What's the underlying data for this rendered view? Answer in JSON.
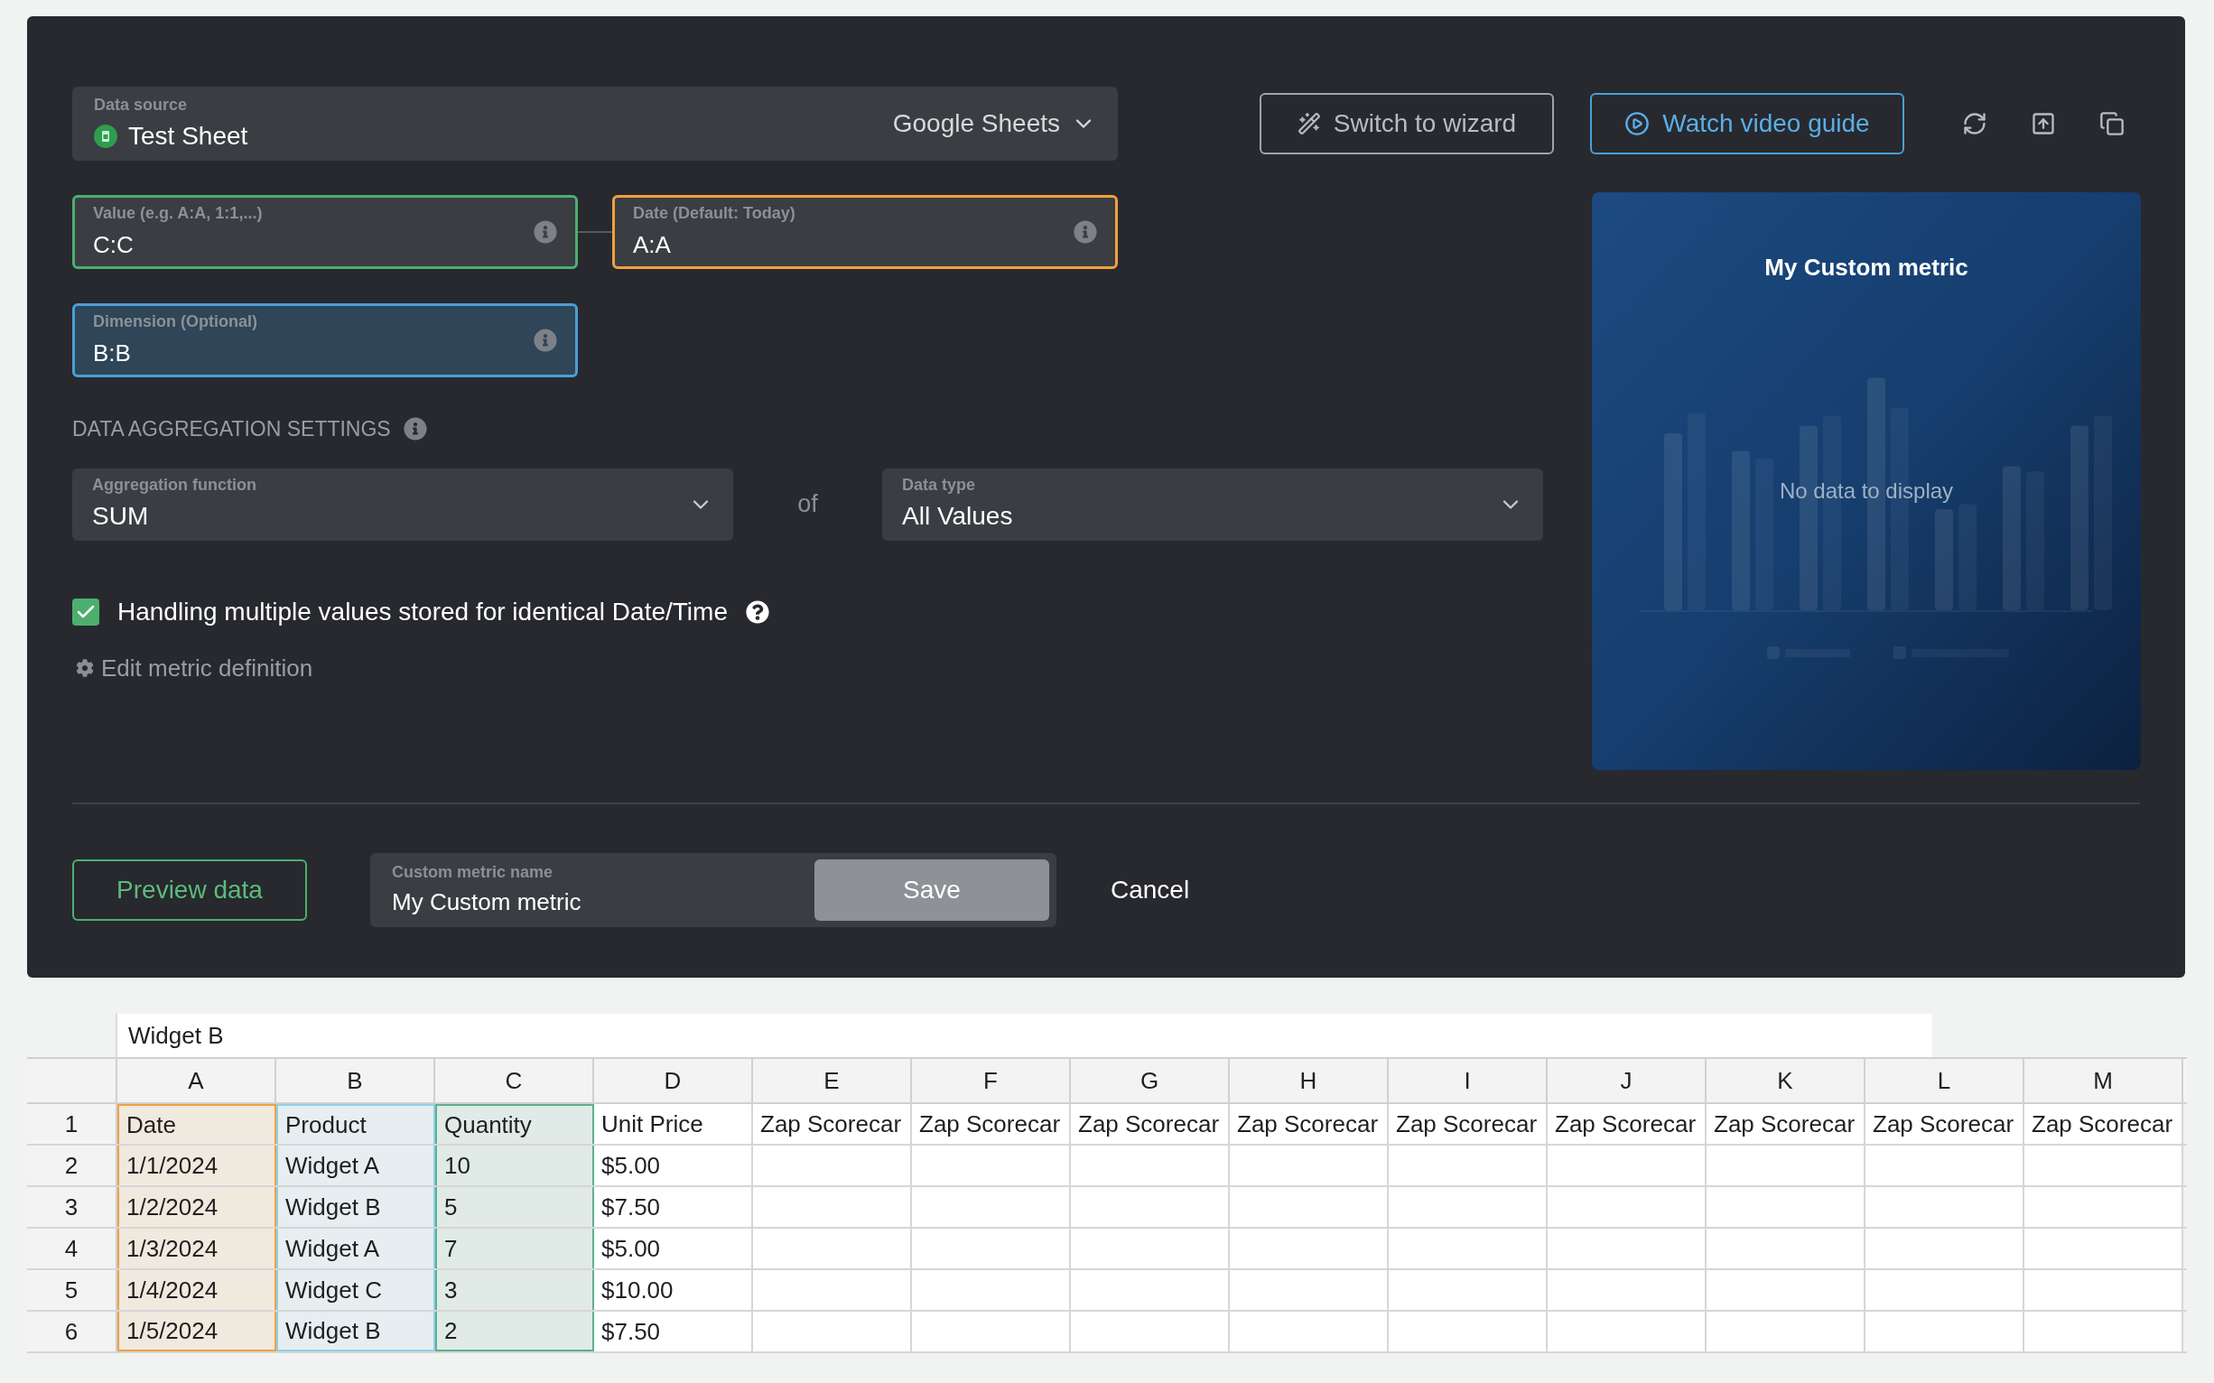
{
  "data_source": {
    "label": "Data source",
    "value": "Test Sheet",
    "provider": "Google Sheets"
  },
  "header_buttons": [
    {
      "kind": "wizard",
      "label": "Switch to wizard"
    },
    {
      "kind": "video",
      "label": "Watch video guide"
    }
  ],
  "fields": [
    {
      "label": "Value (e.g. A:A, 1:1,...)",
      "value": "C:C",
      "color": "#4caf6e",
      "focused": false
    },
    {
      "label": "Date (Default: Today)",
      "value": "A:A",
      "color": "#f0a040",
      "focused": false
    },
    {
      "label": "Dimension (Optional)",
      "value": "B:B",
      "color": "#4a9fd8",
      "focused": true
    }
  ],
  "aggregation": {
    "heading": "DATA AGGREGATION SETTINGS",
    "function_label": "Aggregation function",
    "function_value": "SUM",
    "joiner": "of",
    "type_label": "Data type",
    "type_value": "All Values"
  },
  "handling_multiple": {
    "label": "Handling multiple values stored for identical Date/Time",
    "checked": true
  },
  "edit_link": "Edit metric definition",
  "preview": {
    "title": "My Custom metric",
    "empty_message": "No data to display"
  },
  "footer": {
    "preview_button": "Preview data",
    "name_label": "Custom metric name",
    "name_value": "My Custom metric",
    "save": "Save",
    "cancel": "Cancel"
  },
  "sheet": {
    "formula_bar": "Widget B",
    "columns": [
      {
        "label": "A",
        "color": "#f0a040"
      },
      {
        "label": "B",
        "color": "#8fd0ea"
      },
      {
        "label": "C",
        "color": "#5fb08a"
      },
      {
        "label": "D"
      },
      {
        "label": "E"
      },
      {
        "label": "F"
      },
      {
        "label": "G"
      },
      {
        "label": "H"
      },
      {
        "label": "I"
      },
      {
        "label": "J"
      },
      {
        "label": "K"
      },
      {
        "label": "L"
      },
      {
        "label": "M"
      }
    ],
    "rows": [
      {
        "number": "1",
        "cells": [
          "Date",
          "Product",
          "Quantity",
          "Unit Price",
          "Zap Scorecar",
          "Zap Scorecar",
          "Zap Scorecar",
          "Zap Scorecar",
          "Zap Scorecar",
          "Zap Scorecar",
          "Zap Scorecar",
          "Zap Scorecar",
          "Zap Scorecar"
        ]
      },
      {
        "number": "2",
        "cells": [
          "1/1/2024",
          "Widget A",
          "10",
          "$5.00"
        ]
      },
      {
        "number": "3",
        "cells": [
          "1/2/2024",
          "Widget B",
          "5",
          "$7.50"
        ]
      },
      {
        "number": "4",
        "cells": [
          "1/3/2024",
          "Widget A",
          "7",
          "$5.00"
        ]
      },
      {
        "number": "5",
        "cells": [
          "1/4/2024",
          "Widget C",
          "3",
          "$10.00"
        ]
      },
      {
        "number": "6",
        "cells": [
          "1/5/2024",
          "Widget B",
          "2",
          "$7.50"
        ]
      }
    ]
  }
}
